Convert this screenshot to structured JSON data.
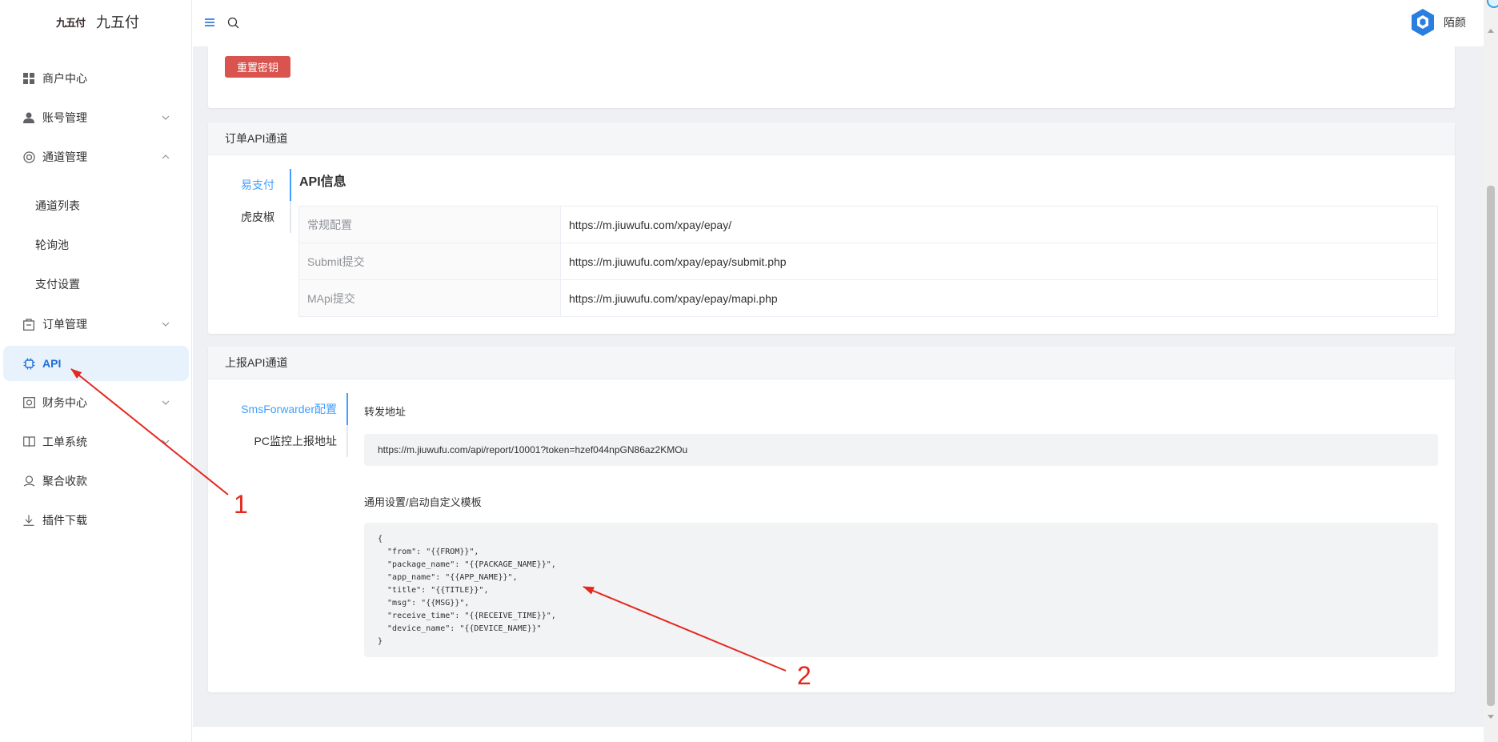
{
  "app": {
    "logo_mark": "九五付",
    "name": "九五付"
  },
  "topbar": {
    "user_name": "陌颜"
  },
  "sidebar": {
    "items": [
      {
        "label": "商户中心",
        "icon": "dashboard-icon"
      },
      {
        "label": "账号管理",
        "icon": "user-icon",
        "chevron": "down"
      },
      {
        "label": "通道管理",
        "icon": "channel-icon",
        "chevron": "up"
      },
      {
        "label": "通道列表",
        "sub": true
      },
      {
        "label": "轮询池",
        "sub": true
      },
      {
        "label": "支付设置",
        "sub": true
      },
      {
        "label": "订单管理",
        "icon": "order-icon",
        "chevron": "down"
      },
      {
        "label": "API",
        "icon": "chip-icon",
        "active": true
      },
      {
        "label": "财务中心",
        "icon": "finance-icon",
        "chevron": "down"
      },
      {
        "label": "工单系统",
        "icon": "book-icon",
        "chevron": "down"
      },
      {
        "label": "聚合收款",
        "icon": "collect-icon"
      },
      {
        "label": "插件下载",
        "icon": "download-icon"
      }
    ]
  },
  "key_card": {
    "reset_button": "重置密钥"
  },
  "order_api": {
    "header": "订单API通道",
    "tabs": [
      "易支付",
      "虎皮椒"
    ],
    "active_tab": 0,
    "info_title": "API信息",
    "rows": [
      {
        "key": "常规配置",
        "value": "https://m.jiuwufu.com/xpay/epay/"
      },
      {
        "key": "Submit提交",
        "value": "https://m.jiuwufu.com/xpay/epay/submit.php"
      },
      {
        "key": "MApi提交",
        "value": "https://m.jiuwufu.com/xpay/epay/mapi.php"
      }
    ]
  },
  "report_api": {
    "header": "上报API通道",
    "tabs": [
      "SmsForwarder配置",
      "PC监控上报地址"
    ],
    "active_tab": 0,
    "forward_label": "转发地址",
    "forward_url": "https://m.jiuwufu.com/api/report/10001?token=hzef044npGN86az2KMOu",
    "template_label": "通用设置/启动自定义模板",
    "template": "{\n  \"from\": \"{{FROM}}\",\n  \"package_name\": \"{{PACKAGE_NAME}}\",\n  \"app_name\": \"{{APP_NAME}}\",\n  \"title\": \"{{TITLE}}\",\n  \"msg\": \"{{MSG}}\",\n  \"receive_time\": \"{{RECEIVE_TIME}}\",\n  \"device_name\": \"{{DEVICE_NAME}}\"\n}"
  },
  "annotations": [
    {
      "number": "1"
    },
    {
      "number": "2"
    }
  ],
  "colors": {
    "accent": "#409eff",
    "active_nav_bg": "#e8f2fd",
    "danger": "#d9534f",
    "annotation": "#e5271c"
  }
}
